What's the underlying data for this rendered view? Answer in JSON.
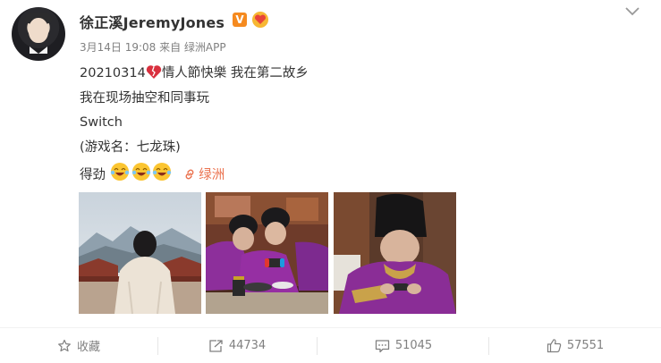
{
  "post": {
    "username": "徐正溪JeremyJones",
    "verified_badge": "V",
    "meta": "3月14日 19:08 来自 绿洲APP",
    "lines": {
      "l1": "20210314",
      "l1_rest": "情人節快樂 我在第二故乡",
      "l2": "我在现场抽空和同事玩",
      "l3": "Switch",
      "l4": "(游戏名：七龙珠)",
      "l5": "得劲",
      "link": "绿洲"
    }
  },
  "actions": {
    "favorite_label": "收藏",
    "repost_count": "44734",
    "comment_count": "51045",
    "like_count": "57551"
  },
  "icons": {
    "expand": "chevron-down-icon",
    "link": "link-icon",
    "favorite": "star-icon",
    "repost": "repost-icon",
    "comment": "comment-icon",
    "like": "thumbs-up-icon"
  },
  "colors": {
    "link": "#eb7350",
    "badge": "#f58a1f",
    "muted": "#808080"
  }
}
